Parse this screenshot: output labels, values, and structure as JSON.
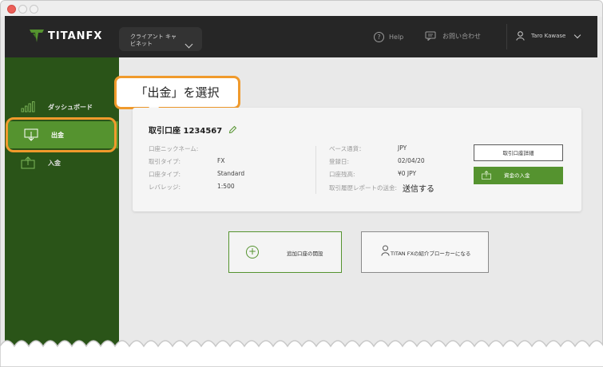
{
  "header": {
    "brand_a": "TITAN",
    "brand_b": "FX",
    "cabinet_label": "クライアント キャビネット",
    "help_label": "Help",
    "contact_label": "お問い合わせ",
    "user_name": "Taro Kawase"
  },
  "sidebar": {
    "items": [
      {
        "label": "ダッシュボード",
        "icon": "bar-chart-icon"
      },
      {
        "label": "出金",
        "icon": "withdraw-icon"
      },
      {
        "label": "入金",
        "icon": "deposit-icon"
      }
    ]
  },
  "callout": {
    "text": "「出金」を選択"
  },
  "account_card": {
    "title": "取引口座 1234567",
    "left_labels": [
      "口座ニックネーム:",
      "取引タイプ:",
      "口座タイプ:",
      "レバレッジ:"
    ],
    "left_values": [
      "",
      "FX",
      "Standard",
      "1:500"
    ],
    "right_labels": [
      "ベース通貨：",
      "登録日:",
      "口座残高:",
      "取引履歴レポートの送金:"
    ],
    "right_values": [
      "JPY",
      "02/04/20",
      "¥0 JPY",
      "送信する"
    ],
    "detail_button": "取引口座詳細",
    "fund_button": "資金の入金"
  },
  "actions": {
    "add_account": "追加口座の開設",
    "become_ib": "TITAN FXの紹介ブローカーになる"
  },
  "colors": {
    "header_bg": "#262626",
    "sidebar_bg": "#2a5418",
    "accent_green": "#55932f",
    "highlight_orange": "#f09a2c"
  }
}
